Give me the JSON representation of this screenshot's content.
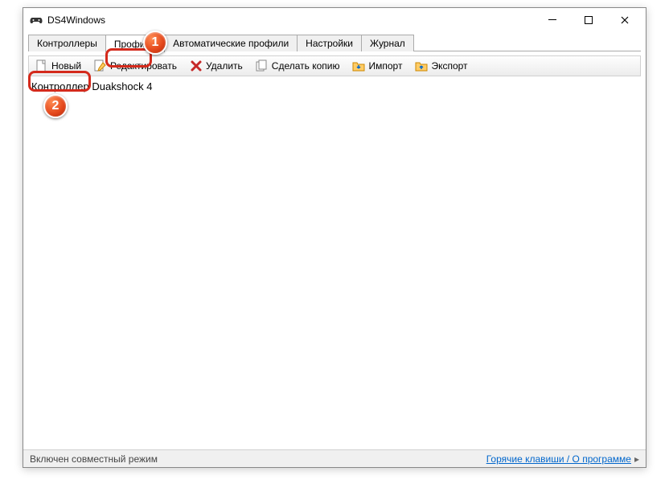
{
  "window": {
    "title": "DS4Windows"
  },
  "tabs": {
    "items": [
      {
        "label": "Контроллеры"
      },
      {
        "label": "Профили"
      },
      {
        "label": "Автоматические профили"
      },
      {
        "label": "Настройки"
      },
      {
        "label": "Журнал"
      }
    ],
    "active_index": 1
  },
  "toolbar": {
    "new": "Новый",
    "edit": "Редактировать",
    "delete": "Удалить",
    "duplicate": "Сделать копию",
    "import": "Импорт",
    "export": "Экспорт"
  },
  "profiles": {
    "items": [
      {
        "name": "Контроллер Duakshock 4"
      }
    ]
  },
  "statusbar": {
    "mode": "Включен совместный режим",
    "hotkeys_link": "Горячие клавиши / О программе"
  },
  "callouts": {
    "one": "1",
    "two": "2"
  }
}
